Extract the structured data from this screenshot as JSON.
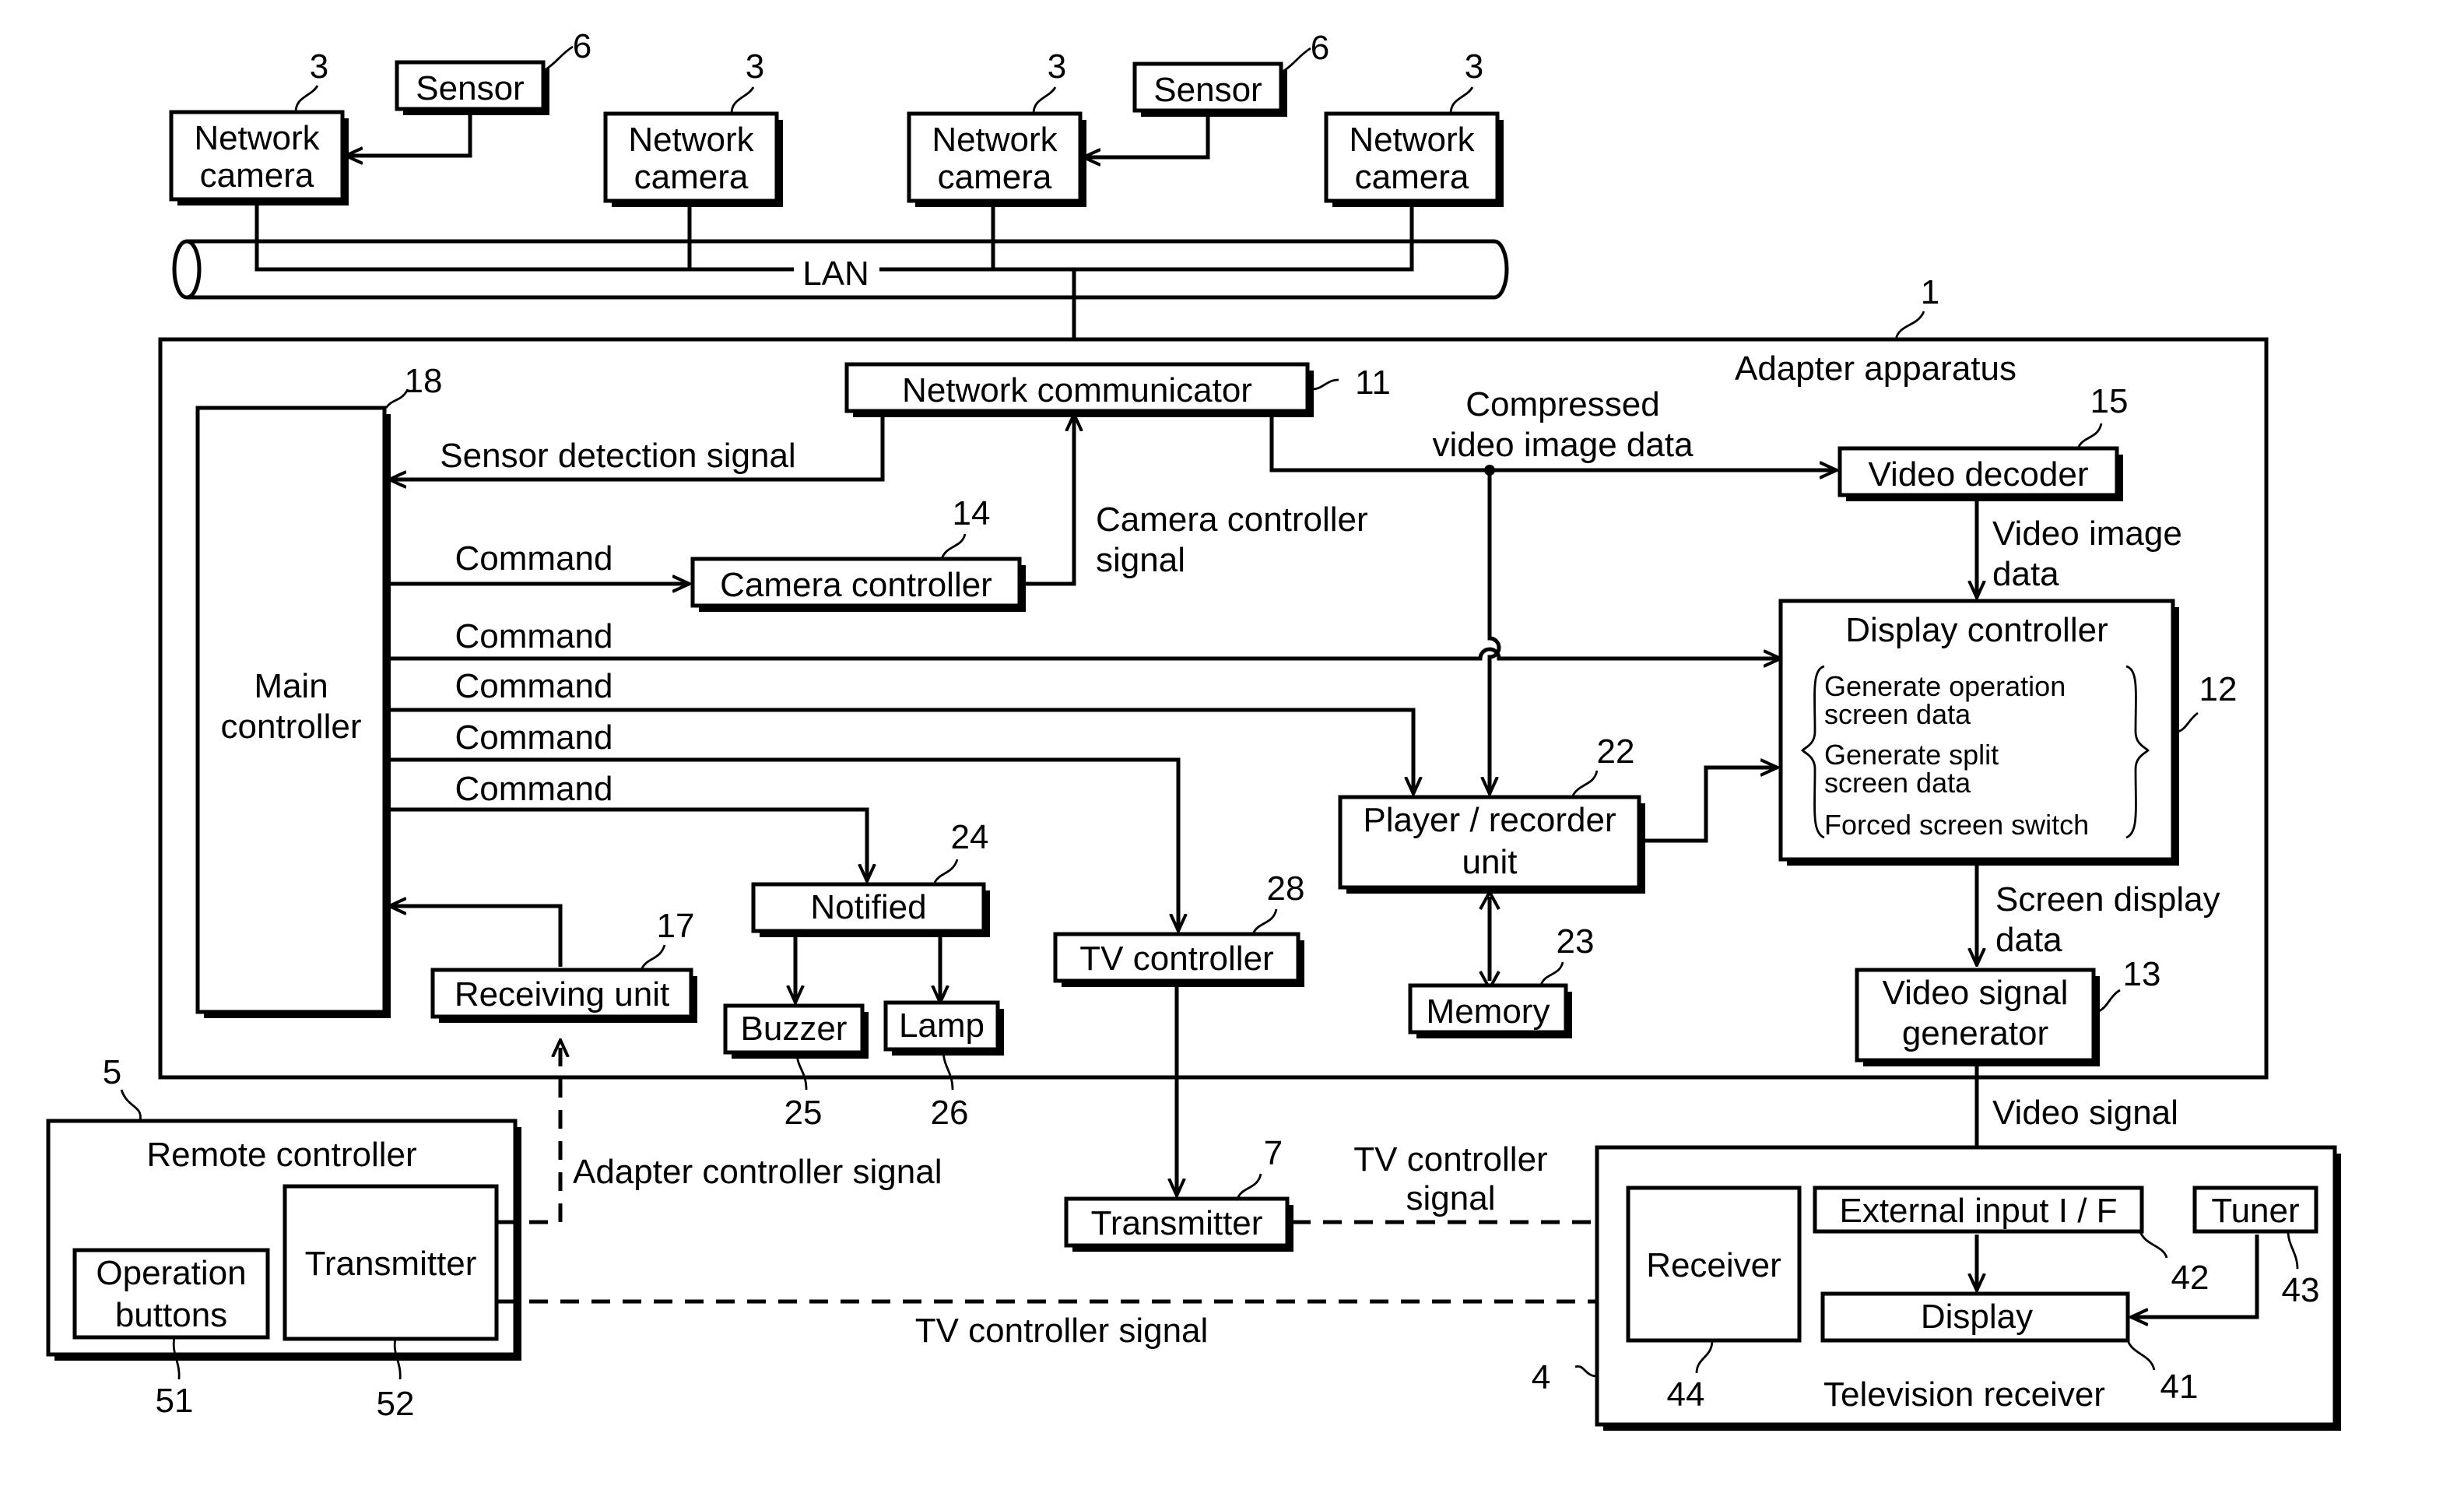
{
  "blocks": {
    "camera1": {
      "lines": [
        "Network",
        "camera"
      ],
      "ref": "3"
    },
    "camera2": {
      "lines": [
        "Network",
        "camera"
      ],
      "ref": "3"
    },
    "camera3": {
      "lines": [
        "Network",
        "camera"
      ],
      "ref": "3"
    },
    "camera4": {
      "lines": [
        "Network",
        "camera"
      ],
      "ref": "3"
    },
    "sensor1": {
      "label": "Sensor",
      "ref": "6"
    },
    "sensor2": {
      "label": "Sensor",
      "ref": "6"
    },
    "lan": {
      "label": "LAN"
    },
    "adapter": {
      "label": "Adapter apparatus",
      "ref": "1"
    },
    "network_communicator": {
      "label": "Network communicator",
      "ref": "11"
    },
    "main_controller": {
      "lines": [
        "Main",
        "controller"
      ],
      "ref": "18"
    },
    "camera_controller": {
      "label": "Camera controller",
      "ref": "14"
    },
    "video_decoder": {
      "label": "Video decoder",
      "ref": "15"
    },
    "display_controller": {
      "label": "Display controller",
      "ref": "12",
      "functions": [
        [
          "Generate operation",
          "screen data"
        ],
        [
          "Generate split",
          "screen data"
        ],
        [
          "Forced screen switch"
        ]
      ]
    },
    "player_recorder": {
      "lines": [
        "Player / recorder",
        "unit"
      ],
      "ref": "22"
    },
    "memory": {
      "label": "Memory",
      "ref": "23"
    },
    "notified": {
      "label": "Notified",
      "ref": "24"
    },
    "buzzer": {
      "label": "Buzzer",
      "ref": "25"
    },
    "lamp": {
      "label": "Lamp",
      "ref": "26"
    },
    "tv_controller": {
      "label": "TV controller",
      "ref": "28"
    },
    "receiving_unit": {
      "label": "Receiving unit",
      "ref": "17"
    },
    "video_signal_generator": {
      "lines": [
        "Video signal",
        "generator"
      ],
      "ref": "13"
    },
    "remote_controller": {
      "label": "Remote controller",
      "ref": "5"
    },
    "operation_buttons": {
      "lines": [
        "Operation",
        "buttons"
      ],
      "ref": "51"
    },
    "rc_transmitter": {
      "label": "Transmitter",
      "ref": "52"
    },
    "transmitter": {
      "label": "Transmitter",
      "ref": "7"
    },
    "television_receiver": {
      "label": "Television receiver",
      "ref": "4"
    },
    "tv_receiver_unit": {
      "label": "Receiver",
      "ref": "44"
    },
    "external_input": {
      "label": "External input I / F",
      "ref": "42"
    },
    "tuner": {
      "label": "Tuner",
      "ref": "43"
    },
    "display": {
      "label": "Display",
      "ref": "41"
    }
  },
  "signals": {
    "sensor_detection": "Sensor detection signal",
    "compressed": [
      "Compressed",
      "video image data"
    ],
    "camera_controller_signal": [
      "Camera controller",
      "signal"
    ],
    "video_image_data": [
      "Video image",
      "data"
    ],
    "command": "Command",
    "screen_display_data": [
      "Screen display",
      "data"
    ],
    "video_signal": "Video signal",
    "adapter_controller_signal": "Adapter controller signal",
    "tv_controller_signal_1": [
      "TV controller",
      "signal"
    ],
    "tv_controller_signal_2": "TV controller signal"
  }
}
